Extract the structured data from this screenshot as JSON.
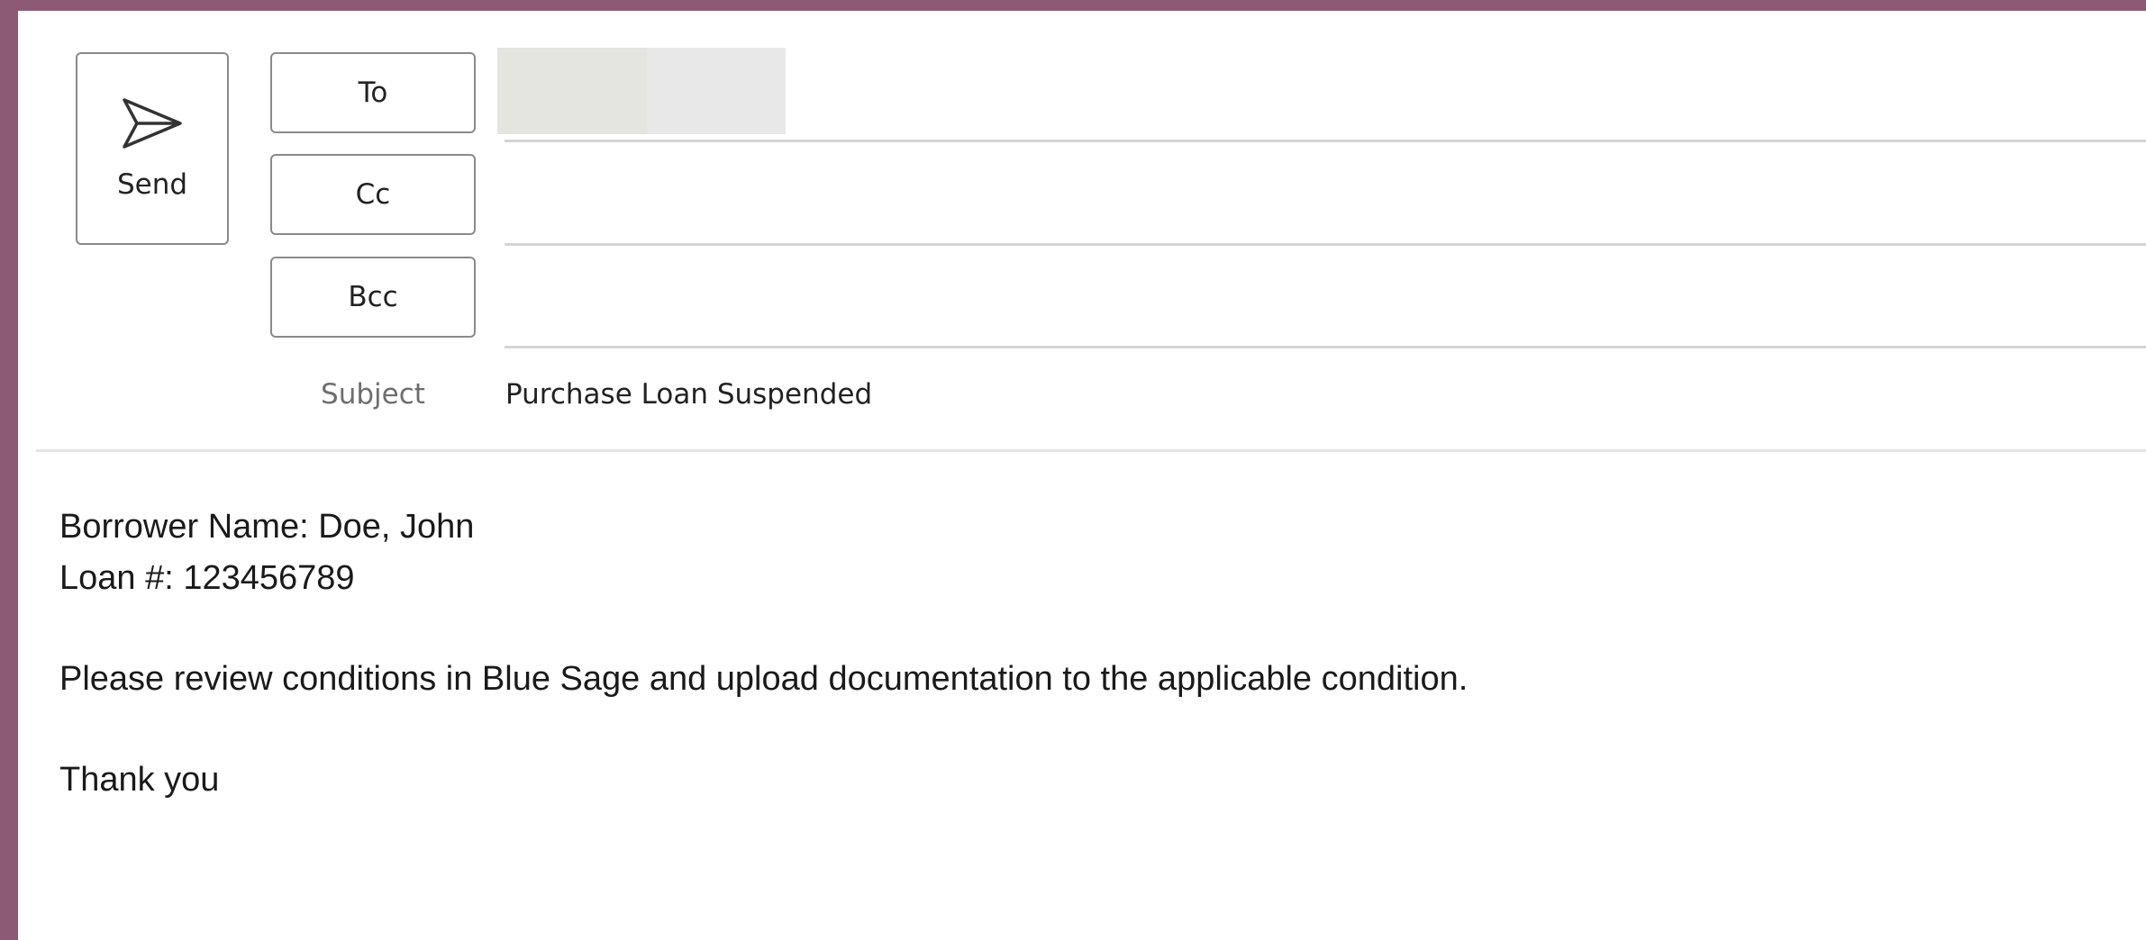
{
  "compose": {
    "send_label": "Send",
    "to_label": "To",
    "cc_label": "Cc",
    "bcc_label": "Bcc",
    "subject_label": "Subject",
    "subject_value": "Purchase Loan Suspended"
  },
  "body": {
    "line1": "Borrower Name: Doe, John",
    "line2": "Loan #: 123456789",
    "line3": "Please review conditions in Blue Sage and upload documentation to the applicable condition.",
    "line4": "Thank you"
  },
  "colors": {
    "frame": "#8c5a74",
    "background": "#ffffff",
    "border": "#8a8a8a"
  },
  "icons": {
    "send": "send-icon"
  }
}
